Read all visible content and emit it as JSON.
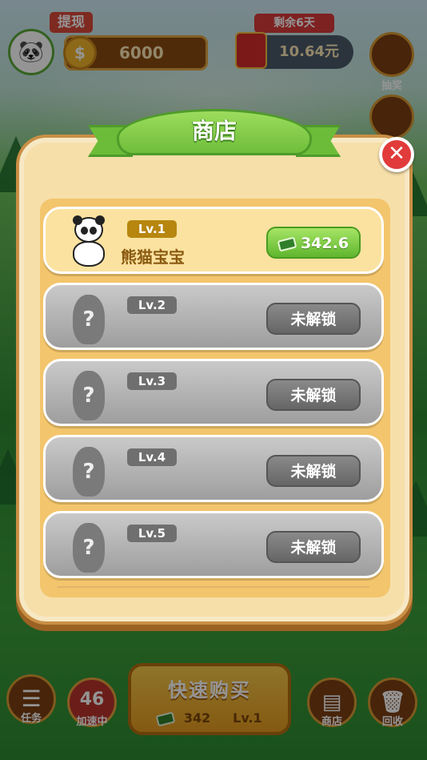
{
  "hud": {
    "withdraw_label": "提现",
    "coins": "6000",
    "days_left": "剩余6天",
    "cash": "10.64元",
    "side_buttons": [
      "抽奖"
    ],
    "bottom_buttons": [
      {
        "label": "任务"
      },
      {
        "label": "加速中",
        "value": "46"
      },
      {
        "label": "商店"
      },
      {
        "label": "回收"
      }
    ],
    "quick_buy": {
      "label": "快速购买",
      "cost": "342",
      "level": "Lv.1"
    }
  },
  "shop": {
    "title": "商店",
    "items": [
      {
        "level": "Lv.1",
        "name": "熊猫宝宝",
        "action": "342.6",
        "locked": false
      },
      {
        "level": "Lv.2",
        "name": "",
        "action": "未解锁",
        "locked": true
      },
      {
        "level": "Lv.3",
        "name": "",
        "action": "未解锁",
        "locked": true
      },
      {
        "level": "Lv.4",
        "name": "",
        "action": "未解锁",
        "locked": true
      },
      {
        "level": "Lv.5",
        "name": "",
        "action": "未解锁",
        "locked": true
      }
    ]
  },
  "colors": {
    "accent_green": "#6fbe3a",
    "close_red": "#e23b3b",
    "modal_bg": "#f6dfa9"
  }
}
